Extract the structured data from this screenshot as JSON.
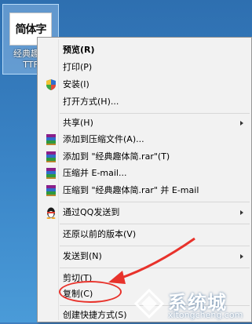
{
  "desktop_icon": {
    "glyph": "简体字",
    "name_line1": "经典趣体",
    "name_line2": "TTF"
  },
  "menu": {
    "preview": "预览(R)",
    "print": "打印(P)",
    "install": "安装(I)",
    "open_with": "打开方式(H)...",
    "share": "共享(H)",
    "add_archive": "添加到压缩文件(A)...",
    "add_to_rar": "添加到 \"经典趣体简.rar\"(T)",
    "compress_email": "压缩并 E-mail...",
    "compress_rar_email": "压缩到 \"经典趣体简.rar\" 并 E-mail",
    "send_qq": "通过QQ发送到",
    "restore_versions": "还原以前的版本(V)",
    "send_to": "发送到(N)",
    "cut": "剪切(T)",
    "copy": "复制(C)",
    "create_shortcut": "创建快捷方式(S)"
  },
  "watermark": {
    "name": "系统城",
    "url": "xitongcheng.com"
  },
  "colors": {
    "annotation_red": "#e8322b",
    "menu_bg": "#f2f2f2",
    "desktop_blue": "#3b86c8"
  }
}
